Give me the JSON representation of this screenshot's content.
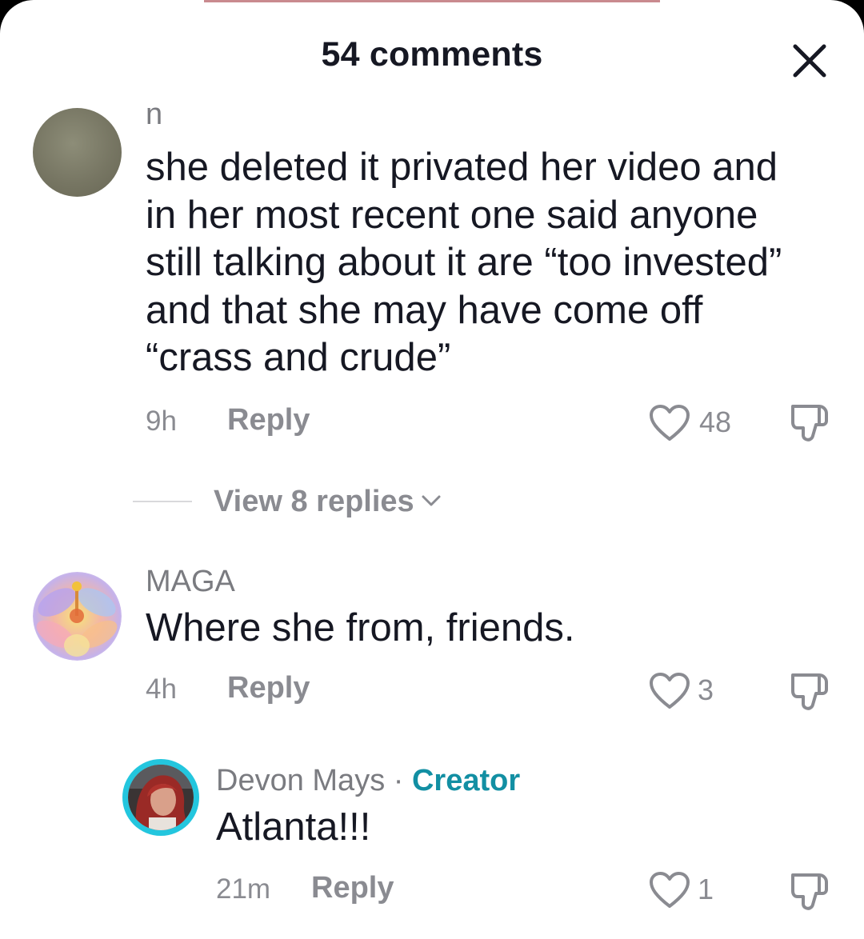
{
  "header": {
    "title": "54 comments",
    "close_icon": "close-icon"
  },
  "comments": [
    {
      "username": "n",
      "text": "she deleted it privated her video and in her most recent one said anyone still talking about it are “too invested” and that she may have come off “crass and crude”",
      "time": "9h",
      "reply_label": "Reply",
      "likes": "48",
      "view_replies_label": "View 8 replies"
    },
    {
      "username": "MAGA",
      "text": "Where she from, friends.",
      "time": "4h",
      "reply_label": "Reply",
      "likes": "3"
    }
  ],
  "reply": {
    "username": "Devon Mays",
    "separator": "·",
    "badge": "Creator",
    "text": "Atlanta!!!",
    "time": "21m",
    "reply_label": "Reply",
    "likes": "1"
  },
  "colors": {
    "text_primary": "#161823",
    "text_secondary": "#8a8b91",
    "creator_accent": "#128fa3",
    "avatar_ring": "#23c6de"
  },
  "icons": [
    "heart-outline-icon",
    "thumbs-down-icon",
    "chevron-down-icon",
    "close-icon"
  ]
}
